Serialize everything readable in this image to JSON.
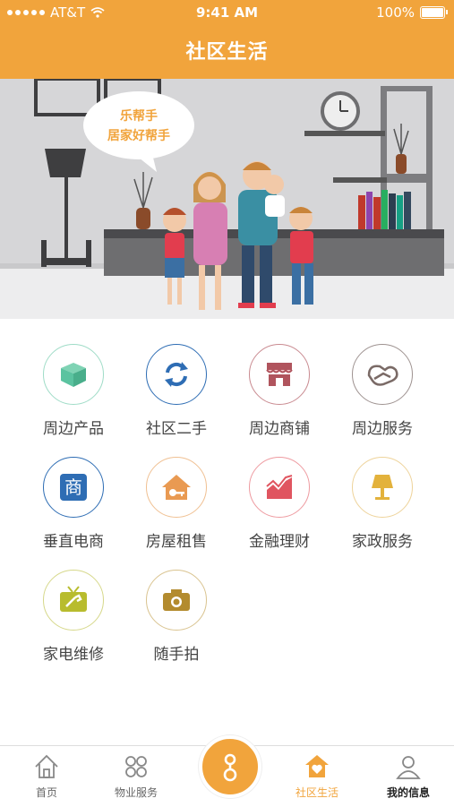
{
  "status": {
    "carrier": "AT&T",
    "time": "9:41 AM",
    "battery": "100%"
  },
  "header": {
    "title": "社区生活"
  },
  "banner": {
    "bubble_line1": "乐帮手",
    "bubble_line2": "居家好帮手"
  },
  "services": [
    {
      "label": "周边产品",
      "icon": "box-icon",
      "color": "#5BC3A0"
    },
    {
      "label": "社区二手",
      "icon": "refresh-icon",
      "color": "#2E6DB4"
    },
    {
      "label": "周边商铺",
      "icon": "shop-icon",
      "color": "#B0545D"
    },
    {
      "label": "周边服务",
      "icon": "handshake-icon",
      "color": "#7A6A66"
    },
    {
      "label": "垂直电商",
      "icon": "shang-icon",
      "color": "#2E6DB4"
    },
    {
      "label": "房屋租售",
      "icon": "house-key-icon",
      "color": "#E99A52"
    },
    {
      "label": "金融理财",
      "icon": "chart-icon",
      "color": "#E05560"
    },
    {
      "label": "家政服务",
      "icon": "lamp-icon",
      "color": "#E3B23C"
    },
    {
      "label": "家电维修",
      "icon": "tv-repair-icon",
      "color": "#B8BC2E"
    },
    {
      "label": "随手拍",
      "icon": "camera-icon",
      "color": "#B38B2E"
    }
  ],
  "tabs": [
    {
      "label": "首页"
    },
    {
      "label": "物业服务"
    },
    {
      "label": "社区生活"
    },
    {
      "label": "我的信息"
    }
  ],
  "colors": {
    "accent": "#F1A43C"
  }
}
